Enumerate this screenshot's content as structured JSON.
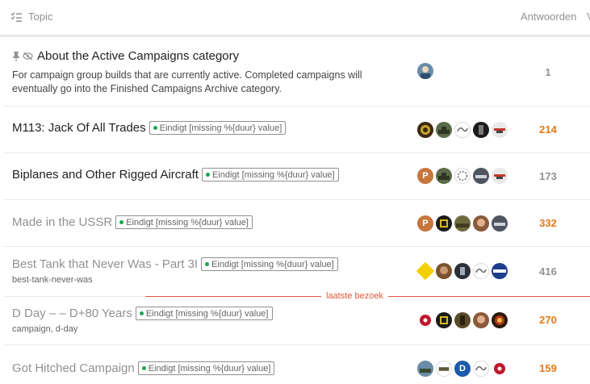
{
  "header": {
    "topic_label": "Topic",
    "replies_label": "Antwoorden",
    "views_label": "V"
  },
  "last_visit_label": "laatste bezoek",
  "colors": {
    "hot_count": "#e67a17",
    "cold_count": "#919191",
    "status_dot": "#1ca551",
    "last_visit_line": "#e45735"
  },
  "topics": [
    {
      "title": "About the Active Campaigns category",
      "pinned": true,
      "excerpt": "For campaign group builds that are currently active. Completed campaigns will eventually go into the Finished Campaigns Archive category.",
      "replies": "1"
    },
    {
      "title": "M113: Jack Of All Trades",
      "status": "Eindigt [missing %{duur} value]",
      "replies": "214"
    },
    {
      "title": "Biplanes and Other Rigged Aircraft",
      "status": "Eindigt [missing %{duur} value]",
      "replies": "173"
    },
    {
      "title": "Made in the USSR",
      "status": "Eindigt [missing %{duur} value]",
      "replies": "332"
    },
    {
      "title": "Best Tank that Never Was - Part 3I",
      "status": "Eindigt [missing %{duur} value]",
      "tags": "best-tank-never-was",
      "replies": "416"
    },
    {
      "title": "D Day – – D+80 Years",
      "status": "Eindigt [missing %{duur} value]",
      "tags": "campaign, d-day",
      "replies": "270"
    },
    {
      "title": "Got Hitched Campaign",
      "status": "Eindigt [missing %{duur} value]",
      "replies": "159"
    }
  ],
  "avatar_letters": {
    "p": "P",
    "d": "D"
  },
  "icons": [
    "list-check-icon",
    "pin-icon",
    "eye-slash-icon"
  ]
}
